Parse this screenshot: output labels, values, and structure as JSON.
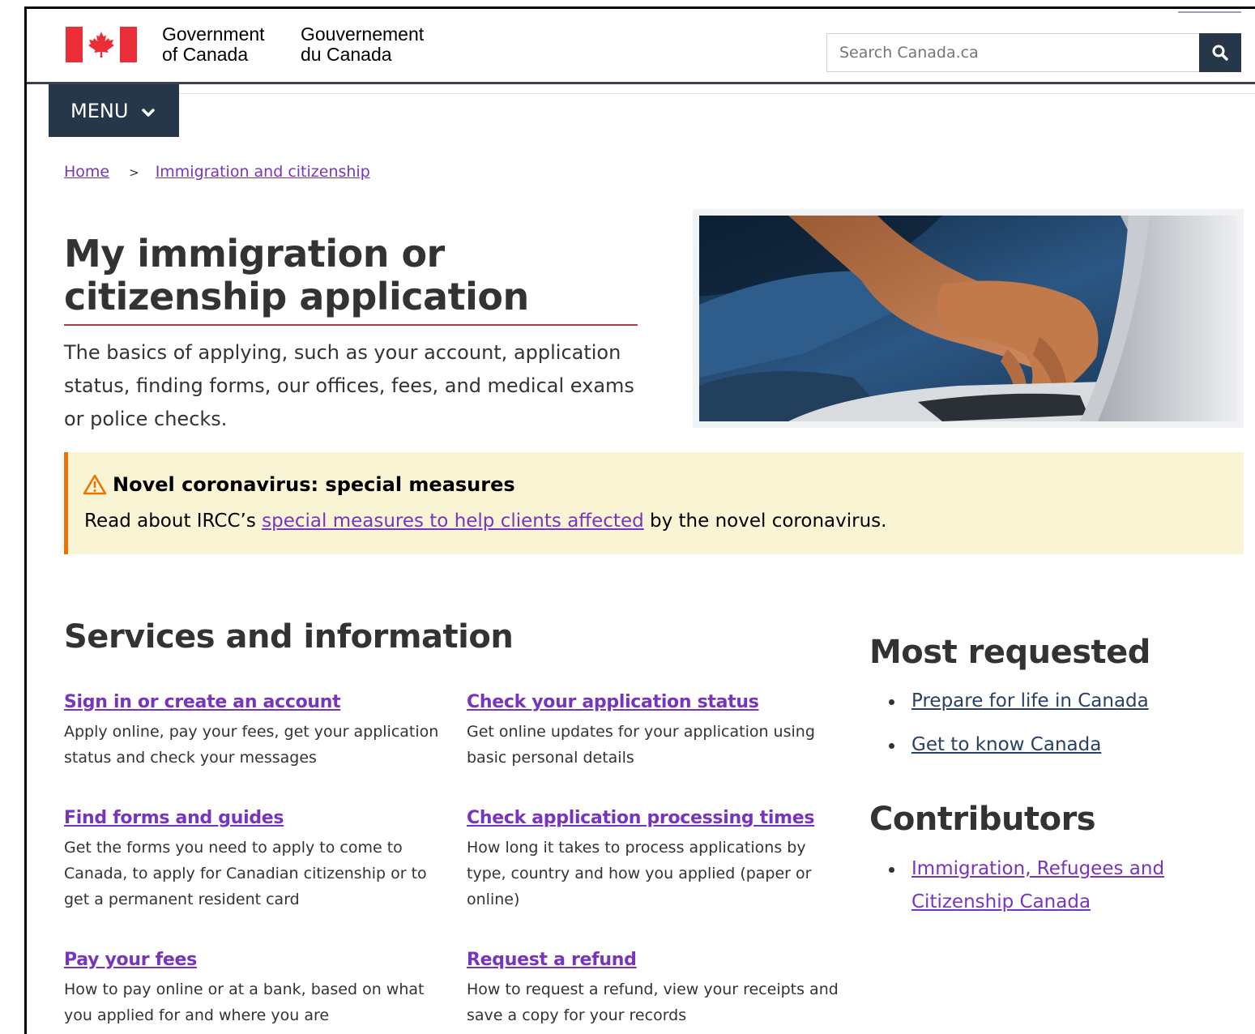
{
  "header": {
    "signature_en": [
      "Government",
      "of Canada"
    ],
    "signature_fr": [
      "Gouvernement",
      "du Canada"
    ],
    "search_placeholder": "Search Canada.ca",
    "menu_label": "MENU"
  },
  "breadcrumb": [
    {
      "label": "Home"
    },
    {
      "label": "Immigration and citizenship"
    }
  ],
  "page": {
    "title": "My immigration or citizenship application",
    "intro": "The basics of applying, such as your account, application status, finding forms, our offices, fees, and medical exams or police checks."
  },
  "alert": {
    "heading": "Novel coronavirus: special measures",
    "body_before": "Read about IRCC’s ",
    "link": "special measures to help clients affected",
    "body_after": " by the novel coronavirus."
  },
  "services": {
    "heading": "Services and information",
    "items": [
      {
        "title": "Sign in or create an account",
        "desc": "Apply online, pay your fees, get your application status and check your messages"
      },
      {
        "title": "Check your application status",
        "desc": "Get online updates for your application using basic personal details"
      },
      {
        "title": "Find forms and guides",
        "desc": "Get the forms you need to apply to come to Canada, to apply for Canadian citizenship or to get a permanent resident card"
      },
      {
        "title": "Check application processing times",
        "desc": "How long it takes to process applications by type, country and how you applied (paper or online)"
      },
      {
        "title": "Pay your fees",
        "desc": "How to pay online or at a bank, based on what you applied for and where you are"
      },
      {
        "title": "Request a refund",
        "desc": "How to request a refund, view your receipts and save a copy for your records"
      }
    ]
  },
  "most_requested": {
    "heading": "Most requested",
    "items": [
      "Prepare for life in Canada",
      "Get to know Canada"
    ]
  },
  "contributors": {
    "heading": "Contributors",
    "items": [
      "Immigration, Refugees and Citizenship Canada"
    ]
  },
  "colors": {
    "link_visited": "#7834bc",
    "link": "#284162",
    "nav_dark": "#26374a",
    "flag_red": "#eb2d37",
    "title_rule": "#af3c43",
    "alert_bg": "#f9f4d4",
    "alert_border": "#ee7100"
  },
  "icons": {
    "search_button": "search-icon",
    "menu_chevron": "chevron-down-icon",
    "alert": "warning-icon"
  }
}
